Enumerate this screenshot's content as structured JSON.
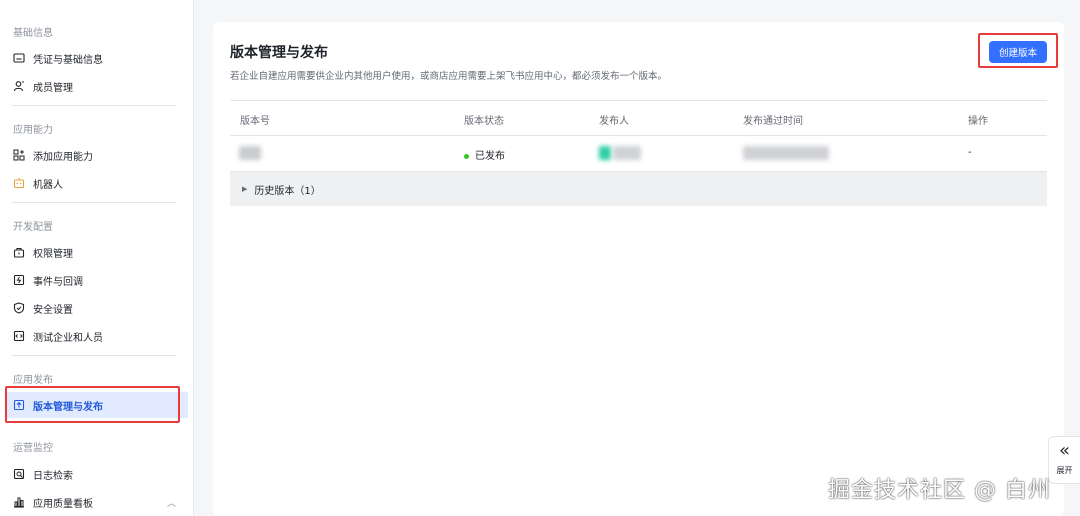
{
  "sidebar": {
    "sections": [
      {
        "title": "基础信息",
        "items": [
          {
            "label": "凭证与基础信息",
            "icon": "credential-icon"
          },
          {
            "label": "成员管理",
            "icon": "member-icon"
          }
        ]
      },
      {
        "title": "应用能力",
        "items": [
          {
            "label": "添加应用能力",
            "icon": "add-capability-icon"
          },
          {
            "label": "机器人",
            "icon": "robot-icon"
          }
        ]
      },
      {
        "title": "开发配置",
        "items": [
          {
            "label": "权限管理",
            "icon": "permission-icon"
          },
          {
            "label": "事件与回调",
            "icon": "event-icon"
          },
          {
            "label": "安全设置",
            "icon": "shield-icon"
          },
          {
            "label": "测试企业和人员",
            "icon": "code-icon"
          }
        ]
      },
      {
        "title": "应用发布",
        "items": [
          {
            "label": "版本管理与发布",
            "icon": "upload-icon",
            "active": true
          }
        ]
      },
      {
        "title": "运营监控",
        "items": [
          {
            "label": "日志检索",
            "icon": "log-search-icon"
          },
          {
            "label": "应用质量看板",
            "icon": "chart-icon"
          }
        ]
      }
    ]
  },
  "main": {
    "title": "版本管理与发布",
    "description": "若企业自建应用需要供企业内其他用户使用，或商店应用需要上架飞书应用中心，都必须发布一个版本。",
    "create_button": "创建版本",
    "table": {
      "headers": [
        "版本号",
        "版本状态",
        "发布人",
        "发布通过时间",
        "操作"
      ],
      "rows": [
        {
          "status": "已发布",
          "action": "-"
        }
      ]
    },
    "history": "历史版本（1）"
  },
  "expand_tab": {
    "label": "展开"
  },
  "watermark": "掘金技术社区 @ 白州",
  "colors": {
    "accent": "#3370ff",
    "active_bg": "#e1eaff",
    "highlight": "#e83b3b",
    "status_success": "#34c724"
  }
}
